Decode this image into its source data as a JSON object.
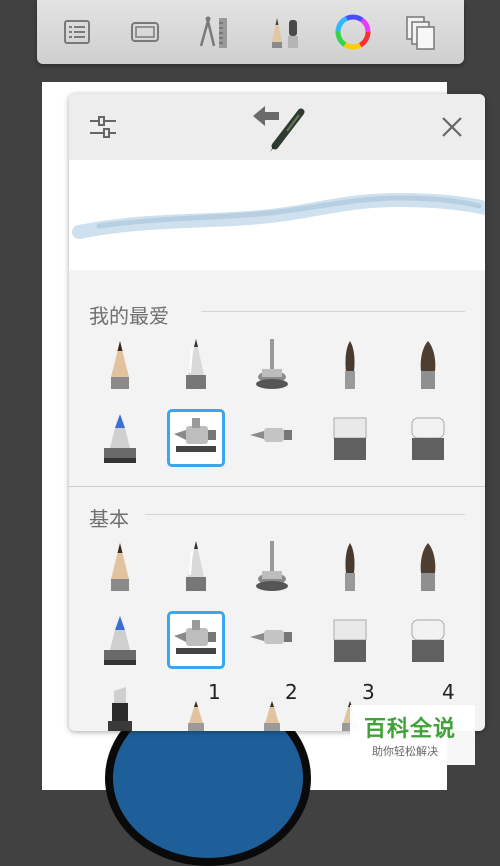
{
  "toolbar": {
    "buttons": [
      {
        "icon": "list-icon"
      },
      {
        "icon": "canvas-icon"
      },
      {
        "icon": "guides-icon"
      },
      {
        "icon": "brushes-icon"
      },
      {
        "icon": "color-wheel-icon"
      },
      {
        "icon": "layers-icon"
      }
    ]
  },
  "panel": {
    "header": {
      "settings_icon": "sliders-icon",
      "brush_icon": "pen-swap-icon",
      "close_icon": "close-icon"
    },
    "favorites": {
      "title": "我的最爱",
      "selected_index": 6
    },
    "basic": {
      "title": "基本",
      "selected_index": 6
    },
    "size_labels": [
      "1",
      "2",
      "3",
      "4"
    ]
  },
  "brushes": [
    "pencil",
    "ballpoint",
    "technical-pen",
    "paint-brush",
    "wide-brush",
    "marker",
    "airbrush",
    "airbrush-fine",
    "soft-eraser",
    "hard-eraser"
  ],
  "watermark": {
    "title": "百科全说",
    "subtitle": "助你轻松解决"
  },
  "colors": {
    "selection": "#3aa6f0",
    "canvas_ink": "#1e5f99",
    "watermark_green": "#3fa236"
  }
}
